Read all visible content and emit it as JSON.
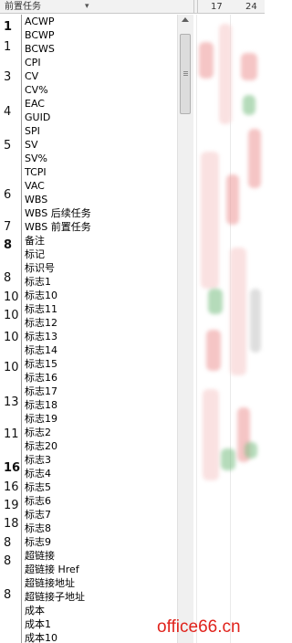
{
  "header": {
    "column_title": "前置任务",
    "days": [
      "17",
      "24"
    ]
  },
  "row_numbers": [
    {
      "text": "1",
      "bold": true
    },
    {
      "text": "1",
      "bold": false
    },
    {
      "text": "3",
      "bold": false
    },
    {
      "text": "4",
      "bold": false
    },
    {
      "text": "5",
      "bold": false
    },
    {
      "text": "6",
      "bold": false
    },
    {
      "text": "7",
      "bold": false
    },
    {
      "text": "8",
      "bold": true
    },
    {
      "text": "8",
      "bold": false
    },
    {
      "text": "10",
      "bold": false
    },
    {
      "text": "10",
      "bold": false
    },
    {
      "text": "10",
      "bold": false
    },
    {
      "text": "10",
      "bold": false
    },
    {
      "text": "13",
      "bold": false
    },
    {
      "text": "11",
      "bold": false
    },
    {
      "text": "16",
      "bold": true
    },
    {
      "text": "16",
      "bold": false
    },
    {
      "text": "19",
      "bold": false
    },
    {
      "text": "18",
      "bold": false
    },
    {
      "text": "8",
      "bold": false
    },
    {
      "text": "8",
      "bold": false
    },
    {
      "text": "8",
      "bold": false
    }
  ],
  "dropdown_options": [
    "ACWP",
    "BCWP",
    "BCWS",
    "CPI",
    "CV",
    "CV%",
    "EAC",
    "GUID",
    "SPI",
    "SV",
    "SV%",
    "TCPI",
    "VAC",
    "WBS",
    "WBS 后续任务",
    "WBS 前置任务",
    "备注",
    "标记",
    "标识号",
    "标志1",
    "标志10",
    "标志11",
    "标志12",
    "标志13",
    "标志14",
    "标志15",
    "标志16",
    "标志17",
    "标志18",
    "标志19",
    "标志2",
    "标志20",
    "标志3",
    "标志4",
    "标志5",
    "标志6",
    "标志7",
    "标志8",
    "标志9",
    "超链接",
    "超链接 Href",
    "超链接地址",
    "超链接子地址",
    "成本",
    "成本1",
    "成本10"
  ],
  "watermark": "office66.cn",
  "colors": {
    "watermark": "#e0231c",
    "bar_red": "#ec9696",
    "bar_green": "#78be82"
  },
  "icons": {
    "dropdown_arrow": "chevron-down-icon",
    "scroll_up": "scroll-up-arrow-icon"
  }
}
